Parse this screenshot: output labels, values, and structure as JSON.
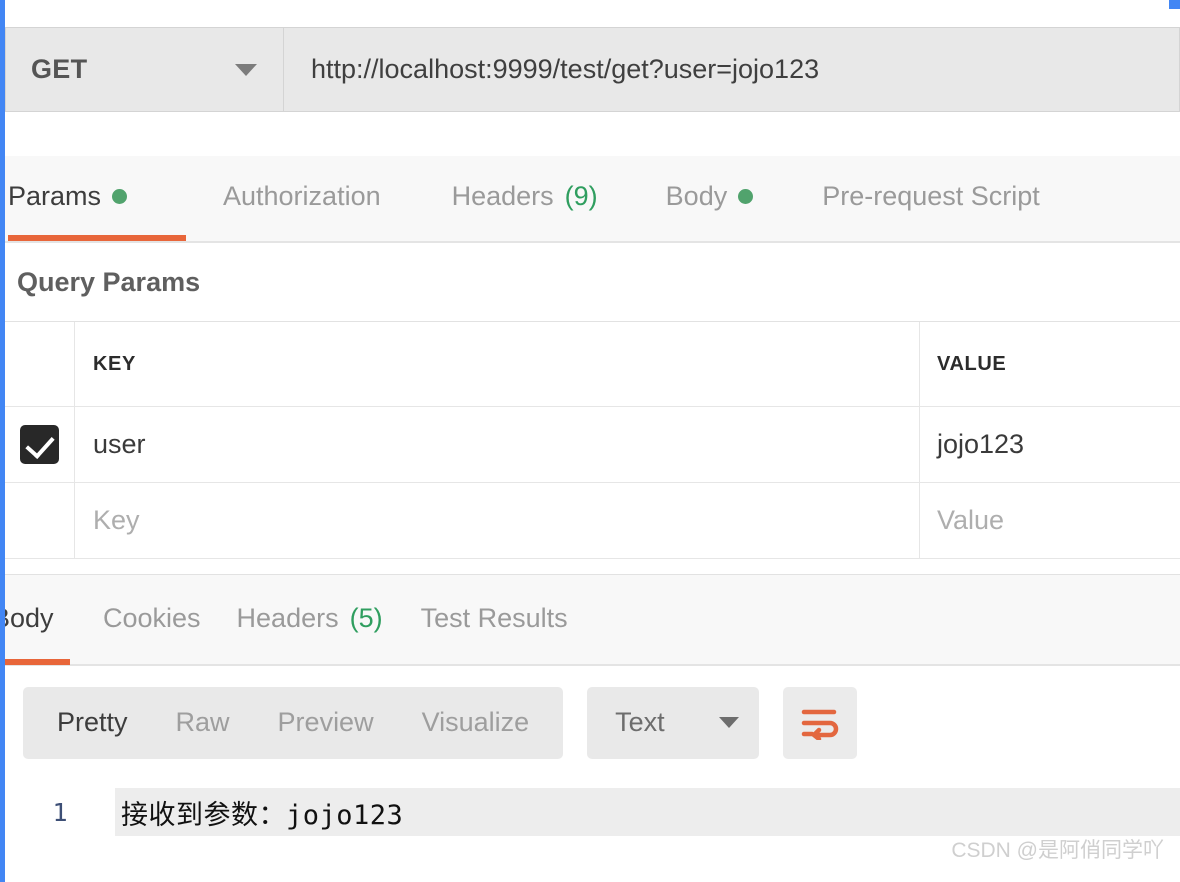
{
  "request": {
    "method": "GET",
    "method_caret": "chevron-down-icon",
    "url": "http://localhost:9999/test/get?user=jojo123",
    "tabs": [
      {
        "label": "Params",
        "indicator": "dot",
        "active": true
      },
      {
        "label": "Authorization",
        "indicator": "none",
        "active": false
      },
      {
        "label": "Headers",
        "count": "(9)",
        "indicator": "count",
        "active": false
      },
      {
        "label": "Body",
        "indicator": "dot",
        "active": false
      },
      {
        "label": "Pre-request Script",
        "indicator": "none",
        "active": false
      }
    ]
  },
  "params": {
    "section_title": "Query Params",
    "columns": {
      "key": "KEY",
      "value": "VALUE"
    },
    "rows": [
      {
        "checked": true,
        "key": "user",
        "value": "jojo123",
        "placeholder": false
      },
      {
        "checked": false,
        "key": "Key",
        "value": "Value",
        "placeholder": true
      }
    ]
  },
  "response": {
    "tabs": [
      {
        "label": "Body",
        "active": true
      },
      {
        "label": "Cookies",
        "active": false
      },
      {
        "label": "Headers",
        "count": "(5)",
        "active": false
      },
      {
        "label": "Test Results",
        "active": false
      }
    ],
    "format_pills": [
      {
        "label": "Pretty",
        "active": true
      },
      {
        "label": "Raw",
        "active": false
      },
      {
        "label": "Preview",
        "active": false
      },
      {
        "label": "Visualize",
        "active": false
      }
    ],
    "type_select": {
      "value": "Text",
      "caret": "chevron-down-icon"
    },
    "wrap_button": {
      "icon": "word-wrap-icon"
    },
    "body_lines": [
      {
        "number": "1",
        "text": "接收到参数：jojo123"
      }
    ]
  },
  "watermark": "CSDN @是阿俏同学吖",
  "colors": {
    "accent_orange": "#e8663a",
    "status_green": "#51a36d",
    "count_green": "#2f9e5f",
    "selection_blue": "#4286f4",
    "control_gray": "#e8e8e8"
  }
}
